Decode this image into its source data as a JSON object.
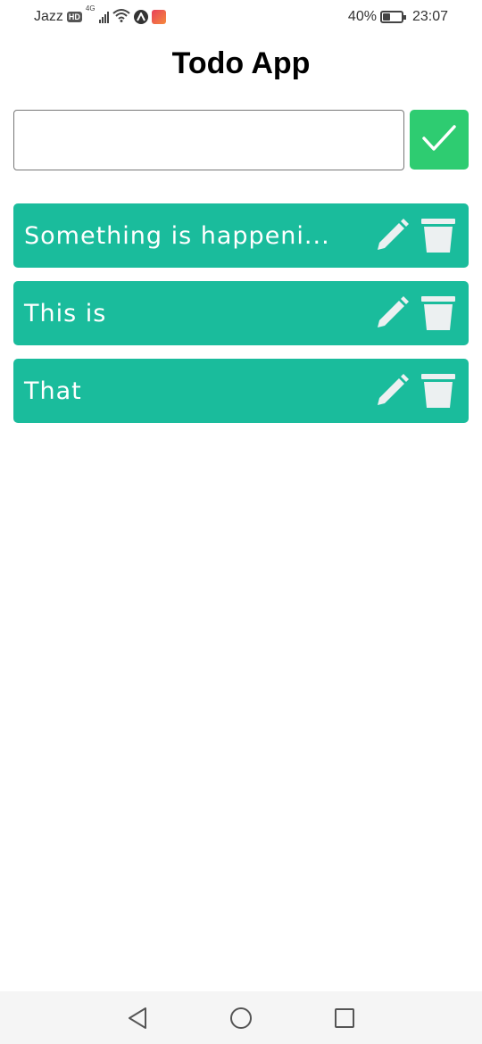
{
  "status_bar": {
    "carrier": "Jazz",
    "hd_badge": "HD",
    "network_type": "4G",
    "battery_percent": "40%",
    "battery_level": 0.4,
    "time": "23:07",
    "icons": [
      "hd-icon",
      "signal-icon",
      "wifi-icon",
      "vpn-icon",
      "app-icon",
      "battery-icon"
    ]
  },
  "header": {
    "title": "Todo App"
  },
  "input": {
    "value": "",
    "placeholder": ""
  },
  "add_button": {
    "icon": "checkmark-icon",
    "color": "#2ecc71"
  },
  "todos": [
    {
      "text": "Something is happeni...",
      "edit_icon": "pencil-icon",
      "delete_icon": "trash-icon"
    },
    {
      "text": "This is",
      "edit_icon": "pencil-icon",
      "delete_icon": "trash-icon"
    },
    {
      "text": "That",
      "edit_icon": "pencil-icon",
      "delete_icon": "trash-icon"
    }
  ],
  "colors": {
    "todo_background": "#1abc9c",
    "todo_text": "#ffffff",
    "icon_color": "#ecf0f1"
  },
  "nav_bar": {
    "buttons": [
      "back-icon",
      "home-icon",
      "recents-icon"
    ]
  }
}
